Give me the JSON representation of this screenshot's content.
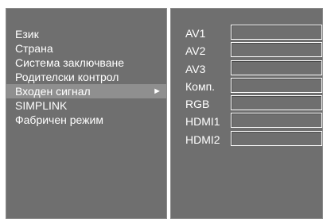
{
  "menu": {
    "items": [
      {
        "label": "Език"
      },
      {
        "label": "Страна"
      },
      {
        "label": "Система заключване"
      },
      {
        "label": "Родителски контрол"
      },
      {
        "label": "Входен сигнал",
        "selected": true,
        "arrow": "►"
      },
      {
        "label": "SIMPLINK"
      },
      {
        "label": "Фабричен режим"
      }
    ]
  },
  "inputs": {
    "items": [
      {
        "label": "AV1",
        "value": ""
      },
      {
        "label": "AV2",
        "value": ""
      },
      {
        "label": "AV3",
        "value": ""
      },
      {
        "label": "Комп.",
        "value": ""
      },
      {
        "label": "RGB",
        "value": ""
      },
      {
        "label": "HDMI1",
        "value": ""
      },
      {
        "label": "HDMI2",
        "value": ""
      }
    ]
  }
}
